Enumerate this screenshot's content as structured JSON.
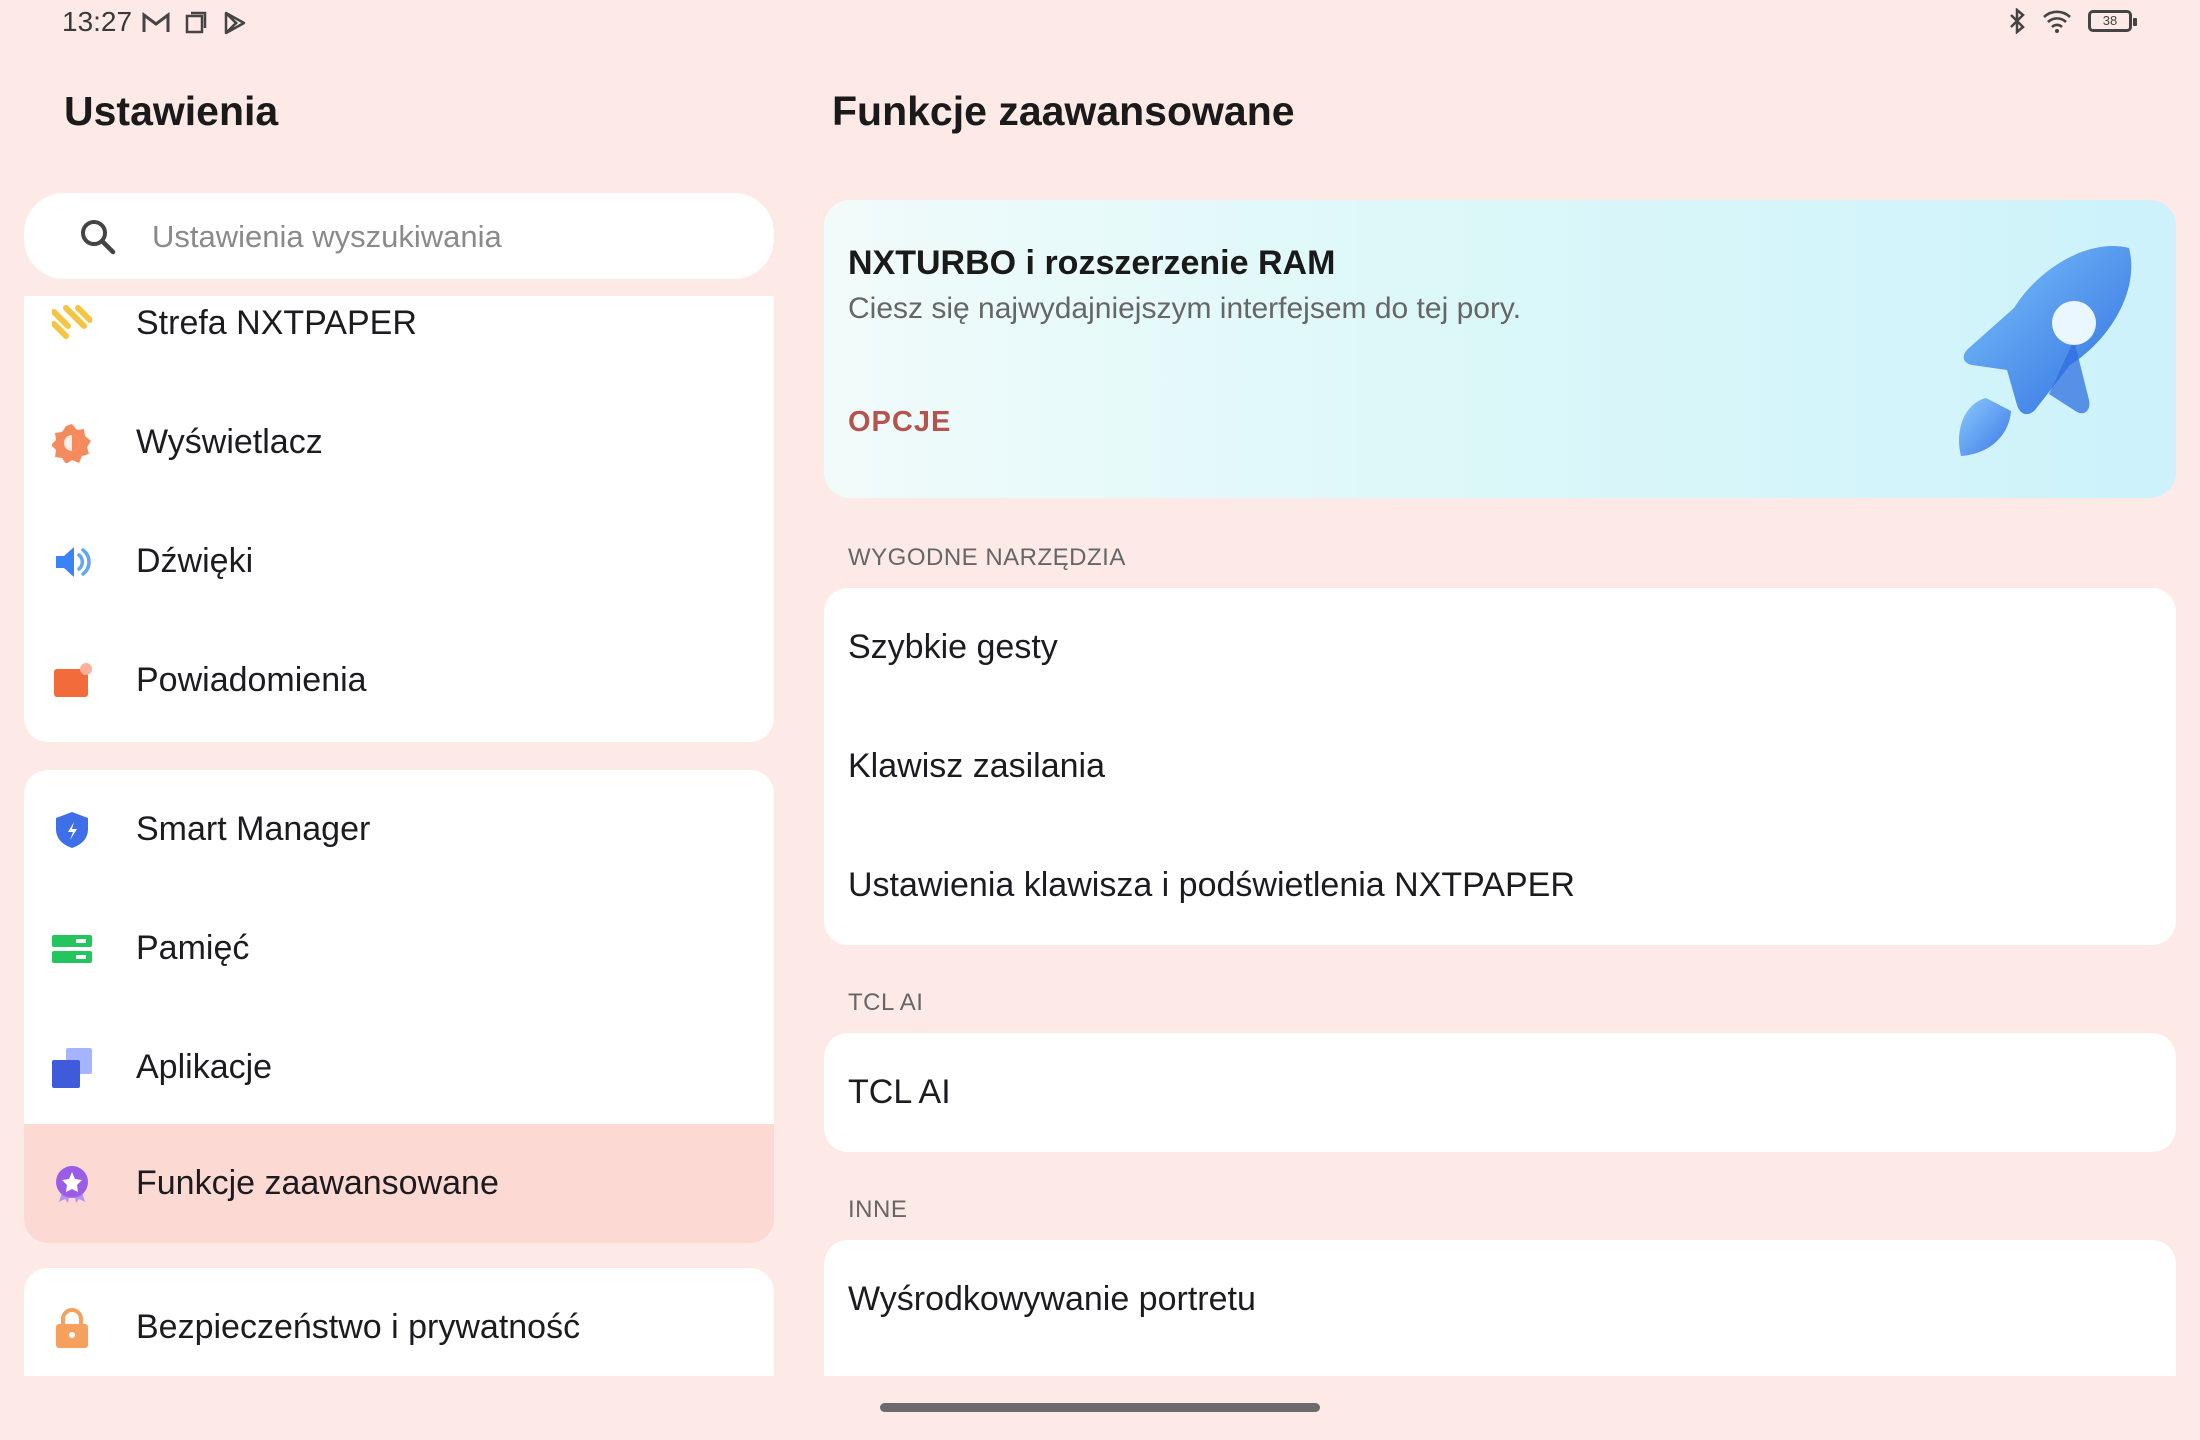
{
  "status_bar": {
    "time": "13:27",
    "left_icons": [
      "gmail-icon",
      "screen-icon",
      "play-store-icon"
    ],
    "right_icons": [
      "bluetooth-icon",
      "wifi-icon",
      "battery-icon"
    ],
    "battery_level": "38"
  },
  "sidebar": {
    "title": "Ustawienia",
    "search_placeholder": "Ustawienia wyszukiwania",
    "groups": [
      [
        {
          "label": "Strefa NXTPAPER",
          "icon": "nxtpaper-icon",
          "color": "#f4c542"
        },
        {
          "label": "Wyświetlacz",
          "icon": "display-icon",
          "color": "#f58a5c"
        },
        {
          "label": "Dźwięki",
          "icon": "speaker-icon",
          "color": "#3b82f6"
        },
        {
          "label": "Powiadomienia",
          "icon": "notification-icon",
          "color": "#f26b3a"
        }
      ],
      [
        {
          "label": "Smart Manager",
          "icon": "shield-icon",
          "color": "#3f6fe8"
        },
        {
          "label": "Pamięć",
          "icon": "storage-icon",
          "color": "#22c55e"
        },
        {
          "label": "Aplikacje",
          "icon": "apps-icon",
          "color": "#4f6bea"
        },
        {
          "label": "Funkcje zaawansowane",
          "icon": "advanced-features-icon",
          "color": "#9b5de5",
          "active": true
        }
      ],
      [
        {
          "label": "Bezpieczeństwo i prywatność",
          "icon": "lock-icon",
          "color": "#f5a05c"
        }
      ]
    ]
  },
  "main": {
    "title": "Funkcje zaawansowane",
    "hero": {
      "title": "NXTURBO i rozszerzenie RAM",
      "subtitle": "Ciesz się najwydajniejszym interfejsem do tej pory.",
      "button": "OPCJE",
      "icon": "rocket-icon"
    },
    "sections": [
      {
        "header": "WYGODNE NARZĘDZIA",
        "items": [
          "Szybkie gesty",
          "Klawisz zasilania",
          "Ustawienia klawisza i podświetlenia NXTPAPER"
        ]
      },
      {
        "header": "TCL AI",
        "items": [
          "TCL AI"
        ]
      },
      {
        "header": "INNE",
        "items": [
          "Wyśrodkowywanie portretu"
        ]
      }
    ]
  },
  "colors": {
    "background": "#fdeae7",
    "active_item": "#fdd9d4",
    "accent_button": "#b4544c",
    "card": "#ffffff"
  }
}
